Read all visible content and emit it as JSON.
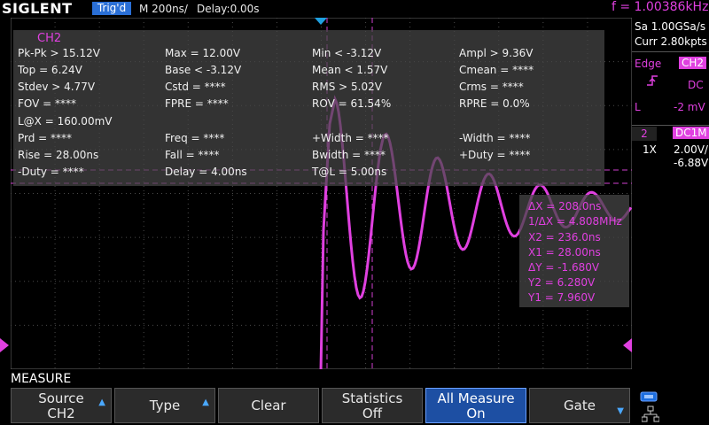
{
  "header": {
    "logo": "SIGLENT",
    "trig_status": "Trig'd",
    "timebase": "M 200ns/",
    "delay": "Delay:0.00s",
    "frequency": "f = 1.00386kHz"
  },
  "measurements": {
    "source_label": "CH2",
    "rows": [
      [
        "Pk-Pk > 15.12V",
        "Max = 12.00V",
        "Min < -3.12V",
        "Ampl > 9.36V"
      ],
      [
        "Top = 6.24V",
        "Base < -3.12V",
        "Mean < 1.57V",
        "Cmean = ****"
      ],
      [
        "Stdev > 4.77V",
        "Cstd = ****",
        "RMS > 5.02V",
        "Crms = ****"
      ],
      [
        "FOV = ****",
        "FPRE = ****",
        "ROV = 61.54%",
        "RPRE = 0.0%"
      ],
      [
        "L@X = 160.00mV",
        "",
        "",
        ""
      ],
      [
        "Prd = ****",
        "Freq = ****",
        "+Width = ****",
        "-Width = ****"
      ],
      [
        "Rise = 28.00ns",
        "Fall = ****",
        "Bwidth = ****",
        "+Duty = ****"
      ],
      [
        "-Duty = ****",
        "Delay = 4.00ns",
        "T@L = 5.00ns",
        ""
      ]
    ]
  },
  "cursors": {
    "lines": [
      "ΔX = 208.0ns",
      "1/ΔX = 4.808MHz",
      "X2 = 236.0ns",
      "X1 = 28.00ns",
      "ΔY = -1.680V",
      "Y2 = 6.280V",
      "Y1 = 7.960V"
    ]
  },
  "right_panel": {
    "sample_rate": "Sa 1.00GSa/s",
    "memory": "Curr 2.80kpts",
    "trigger_type": "Edge",
    "trigger_source": "CH2",
    "trigger_coupling": "DC",
    "trigger_level_label": "L",
    "trigger_level": "-2 mV",
    "channel_number": "2",
    "channel_coupling": "DC1M",
    "probe": "1X",
    "volts_div": "2.00V/",
    "offset": "-6.88V"
  },
  "menu": {
    "title": "MEASURE",
    "buttons": [
      {
        "line1": "Source",
        "line2": "CH2"
      },
      {
        "line1": "Type",
        "line2": ""
      },
      {
        "line1": "Clear",
        "line2": ""
      },
      {
        "line1": "Statistics",
        "line2": "Off"
      },
      {
        "line1": "All Measure",
        "line2": "On"
      },
      {
        "line1": "Gate",
        "line2": ""
      }
    ]
  },
  "colors": {
    "ch2": "#e040e0",
    "accent": "#2a6fd6",
    "trigger_marker": "#1fa0e0"
  }
}
